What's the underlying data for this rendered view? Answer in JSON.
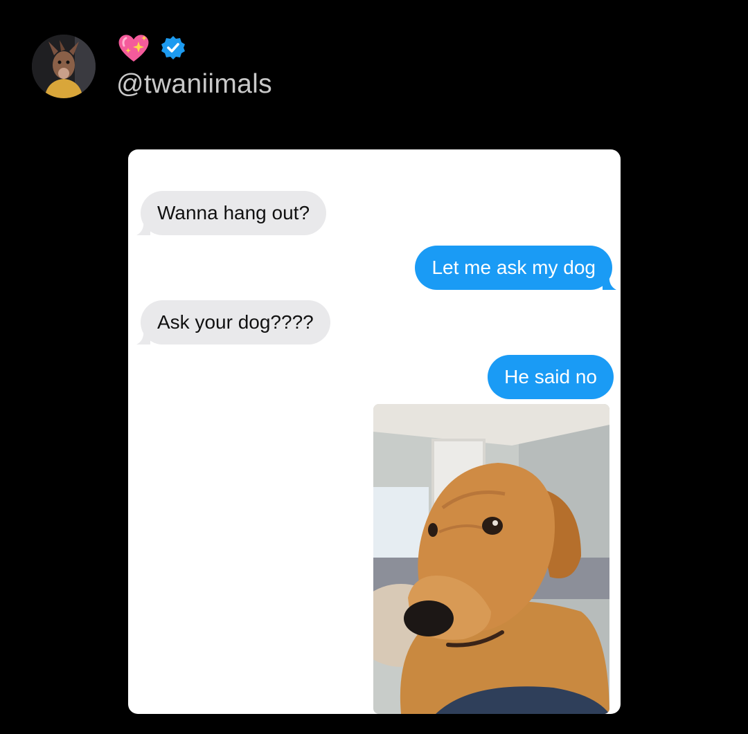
{
  "post": {
    "handle": "@twaniimals",
    "avatar_icon": "dog-avatar-icon",
    "badges": [
      "sparkling-heart-icon",
      "verified-badge-icon"
    ],
    "verified_color": "#1d9bf0"
  },
  "conversation": {
    "messages": [
      {
        "from": "received",
        "text": "Wanna hang out?"
      },
      {
        "from": "sent",
        "text": "Let me ask my dog"
      },
      {
        "from": "received",
        "text": "Ask your dog????"
      },
      {
        "from": "sent",
        "text": "He said no"
      }
    ],
    "attachment_icon": "golden-retriever-photo",
    "colors": {
      "received_bubble": "#e9e9eb",
      "sent_bubble": "#1a9bf5"
    }
  }
}
